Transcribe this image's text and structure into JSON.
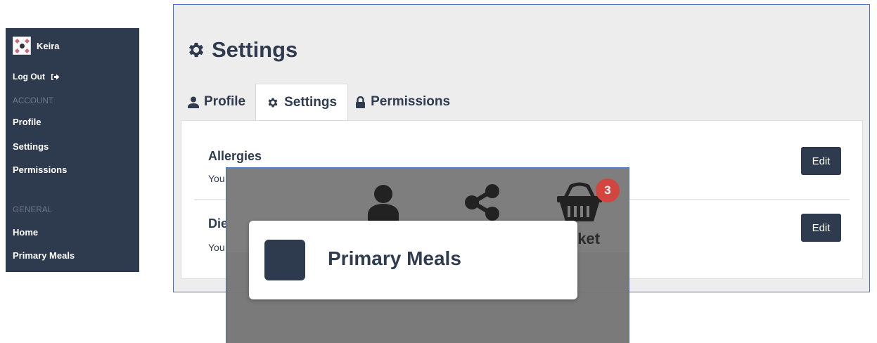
{
  "sidebar": {
    "user_name": "Keira",
    "logout_label": "Log Out",
    "account_section": "ACCOUNT",
    "account_items": [
      {
        "label": "Profile"
      },
      {
        "label": "Settings"
      },
      {
        "label": "Permissions"
      }
    ],
    "general_section": "GENERAL",
    "general_items": [
      {
        "label": "Home"
      },
      {
        "label": "Primary Meals"
      }
    ]
  },
  "page": {
    "title": "Settings",
    "icon": "gear-icon"
  },
  "tabs": [
    {
      "label": "Profile",
      "icon": "user-icon",
      "active": false
    },
    {
      "label": "Settings",
      "icon": "gear-icon",
      "active": true
    },
    {
      "label": "Permissions",
      "icon": "lock-icon",
      "active": false
    }
  ],
  "settings_rows": [
    {
      "title": "Allergies",
      "description": "You",
      "edit_label": "Edit"
    },
    {
      "title": "Die",
      "description": "You",
      "edit_label": "Edit"
    }
  ],
  "overlay": {
    "icons": [
      "user-icon",
      "share-icon",
      "basket-icon"
    ],
    "basket_badge": "3",
    "basket_label": "sket"
  },
  "popup": {
    "label": "Primary Meals"
  },
  "colors": {
    "sidebar_bg": "#2e3a4e",
    "card_bg": "#ededed",
    "button_bg": "#2e3a4e",
    "badge_bg": "#d3453f",
    "frame_border": "#4a6fbf"
  }
}
